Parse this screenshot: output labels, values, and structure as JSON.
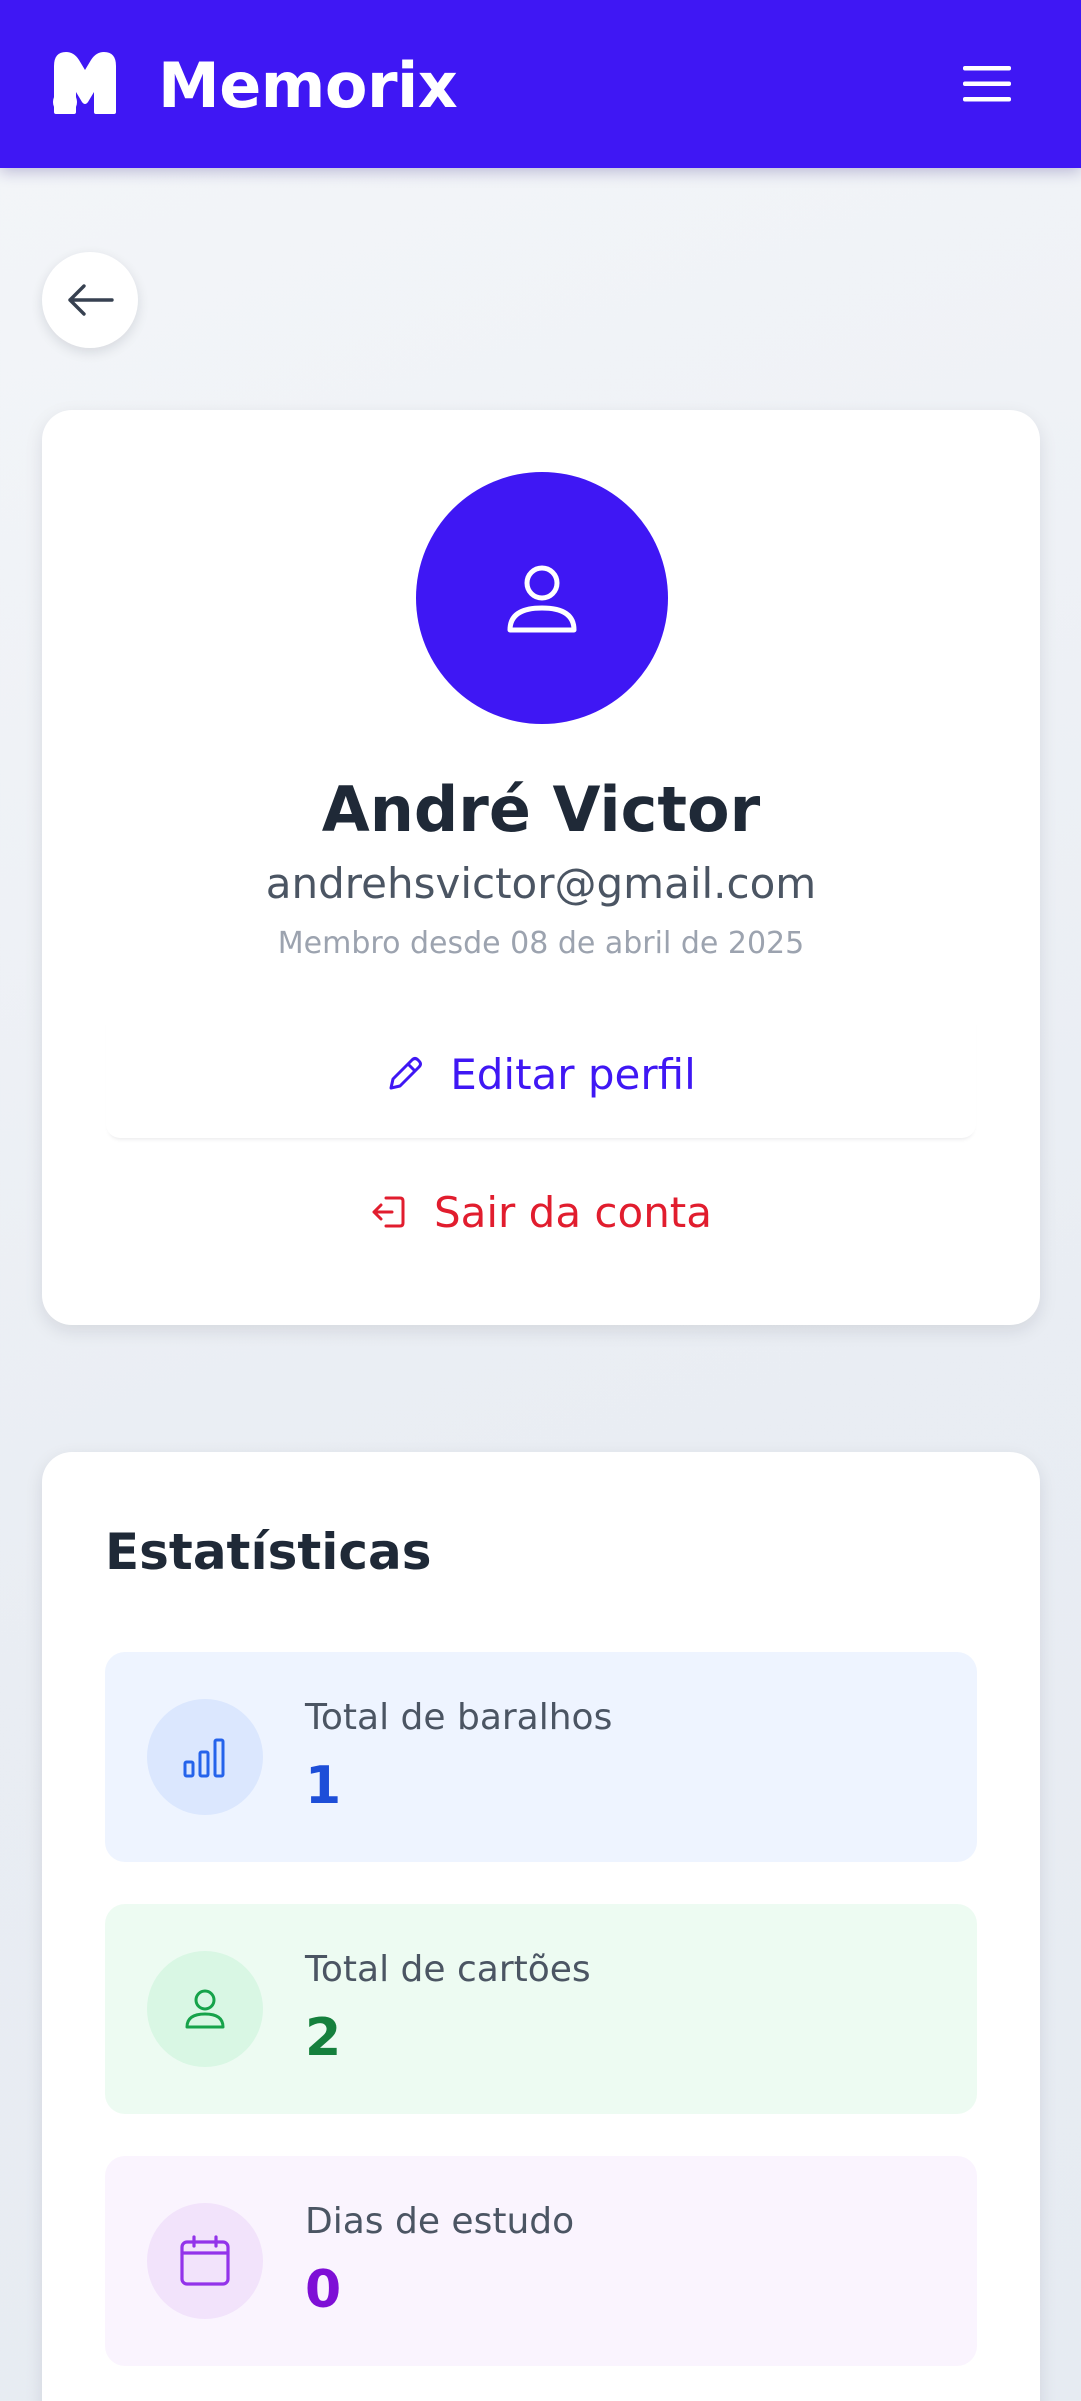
{
  "header": {
    "app_name": "Memorix",
    "logo_icon": "memorix-logo",
    "menu_icon": "hamburger-menu-icon"
  },
  "navigation": {
    "back_icon": "arrow-left-icon"
  },
  "profile": {
    "avatar_icon": "user-icon",
    "name": "André Victor",
    "email": "andrehsvictor@gmail.com",
    "member_since": "Membro desde 08 de abril de 2025",
    "edit_label": "Editar perfil",
    "edit_icon": "pencil-icon",
    "logout_label": "Sair da conta",
    "logout_icon": "logout-icon"
  },
  "stats": {
    "title": "Estatísticas",
    "items": [
      {
        "label": "Total de baralhos",
        "value": "1",
        "icon": "bar-chart-icon",
        "color": "#1d4ed8"
      },
      {
        "label": "Total de cartões",
        "value": "2",
        "icon": "user-icon",
        "color": "#15803d"
      },
      {
        "label": "Dias de estudo",
        "value": "0",
        "icon": "calendar-icon",
        "color": "#7e0fd6"
      }
    ]
  },
  "colors": {
    "brand": "#3f17f4",
    "danger": "#e11d2e",
    "text_primary": "#1f2937",
    "text_muted": "#9ca3af"
  }
}
